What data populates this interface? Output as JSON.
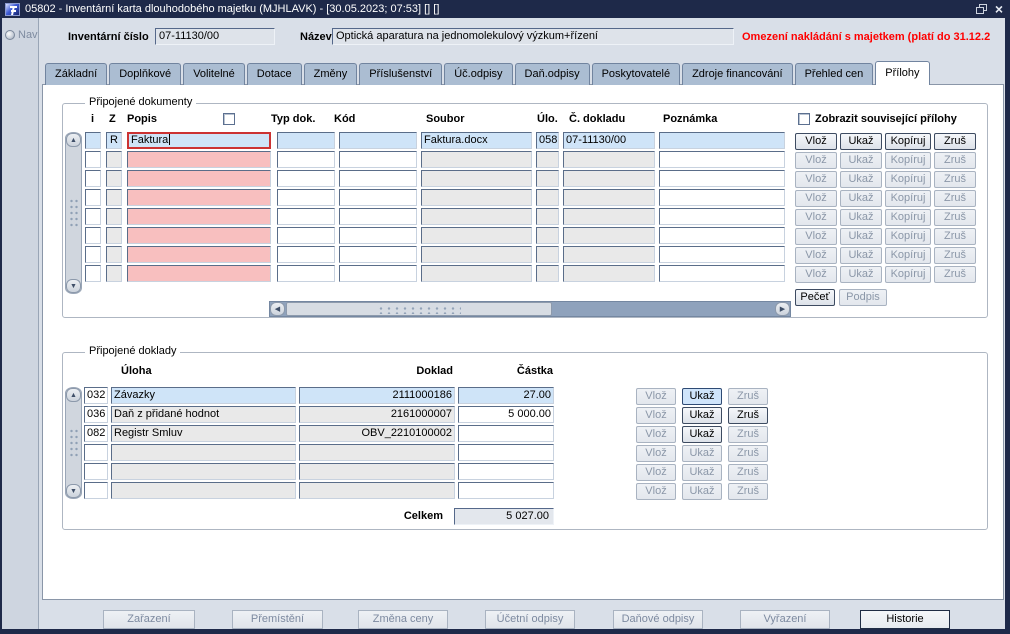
{
  "window": {
    "title": "05802 - Inventární karta dlouhodobého majetku (MJHLAVK) - [30.05.2023; 07:53]  [] []"
  },
  "icons": {
    "close": "×",
    "scroll_up": "▲",
    "scroll_down": "▼",
    "scroll_left": "◀",
    "scroll_right": "▶"
  },
  "nav": {
    "label": "Nav"
  },
  "header": {
    "inventory_label": "Inventární číslo",
    "inventory_value": "07-11130/00",
    "name_label": "Název",
    "name_value": "Optická aparatura na jednomolekulový výzkum+řízení",
    "warning": "Omezení nakládání s majetkem (platí do 31.12.2"
  },
  "tabs": [
    "Základní",
    "Doplňkové",
    "Volitelné",
    "Dotace",
    "Změny",
    "Příslušenství",
    "Úč.odpisy",
    "Daň.odpisy",
    "Poskytovatelé",
    "Zdroje financování",
    "Přehled cen",
    "Přílohy"
  ],
  "active_tab": "Přílohy",
  "documents": {
    "legend": "Připojené dokumenty",
    "headers": {
      "i": "i",
      "z": "Z",
      "popis": "Popis",
      "typ": "Typ dok.",
      "kod": "Kód",
      "soubor": "Soubor",
      "ulo": "Úlo.",
      "cdok": "Č. dokladu",
      "pozn": "Poznámka"
    },
    "show_related_label": "Zobrazit související přílohy",
    "buttons": {
      "insert": "Vlož",
      "show": "Ukaž",
      "copy": "Kopíruj",
      "remove": "Zruš"
    },
    "seal": "Pečeť",
    "sign": "Podpis",
    "rows": [
      {
        "i": "",
        "z": "R",
        "popis": "Faktura",
        "typ": "",
        "kod": "",
        "soubor": "Faktura.docx",
        "ulo": "058",
        "cdok": "07-11130/00",
        "pozn": ""
      },
      {
        "i": "",
        "z": "",
        "popis": "",
        "typ": "",
        "kod": "",
        "soubor": "",
        "ulo": "",
        "cdok": "",
        "pozn": ""
      },
      {
        "i": "",
        "z": "",
        "popis": "",
        "typ": "",
        "kod": "",
        "soubor": "",
        "ulo": "",
        "cdok": "",
        "pozn": ""
      },
      {
        "i": "",
        "z": "",
        "popis": "",
        "typ": "",
        "kod": "",
        "soubor": "",
        "ulo": "",
        "cdok": "",
        "pozn": ""
      },
      {
        "i": "",
        "z": "",
        "popis": "",
        "typ": "",
        "kod": "",
        "soubor": "",
        "ulo": "",
        "cdok": "",
        "pozn": ""
      },
      {
        "i": "",
        "z": "",
        "popis": "",
        "typ": "",
        "kod": "",
        "soubor": "",
        "ulo": "",
        "cdok": "",
        "pozn": ""
      },
      {
        "i": "",
        "z": "",
        "popis": "",
        "typ": "",
        "kod": "",
        "soubor": "",
        "ulo": "",
        "cdok": "",
        "pozn": ""
      },
      {
        "i": "",
        "z": "",
        "popis": "",
        "typ": "",
        "kod": "",
        "soubor": "",
        "ulo": "",
        "cdok": "",
        "pozn": ""
      }
    ]
  },
  "receipts": {
    "legend": "Připojené doklady",
    "headers": {
      "uloha": "Úloha",
      "doklad": "Doklad",
      "castka": "Částka"
    },
    "buttons": {
      "insert": "Vlož",
      "show": "Ukaž",
      "remove": "Zruš"
    },
    "total_label": "Celkem",
    "total_value": "5 027.00",
    "rows": [
      {
        "code": "032",
        "name": "Závazky",
        "doc": "2111000186",
        "amount": "27.00"
      },
      {
        "code": "036",
        "name": "Daň z přidané hodnot",
        "doc": "2161000007",
        "amount": "5 000.00"
      },
      {
        "code": "082",
        "name": "Registr Smluv",
        "doc": "OBV_2210100002",
        "amount": ""
      },
      {
        "code": "",
        "name": "",
        "doc": "",
        "amount": ""
      },
      {
        "code": "",
        "name": "",
        "doc": "",
        "amount": ""
      },
      {
        "code": "",
        "name": "",
        "doc": "",
        "amount": ""
      }
    ]
  },
  "bottom_buttons": [
    {
      "label": "Zařazení",
      "enabled": false
    },
    {
      "label": "Přemístění",
      "enabled": false
    },
    {
      "label": "Změna ceny",
      "enabled": false
    },
    {
      "label": "Účetní odpisy",
      "enabled": false
    },
    {
      "label": "Daňové odpisy",
      "enabled": false
    },
    {
      "label": "Vyřazení",
      "enabled": false
    },
    {
      "label": "Historie",
      "enabled": true
    }
  ],
  "colors": {
    "titlebar": "#1e2949",
    "warning_red": "#ff0000",
    "current_row": "#cfe4f8",
    "required_pink": "#f8bfbf",
    "tab_inactive": "#abbdd2"
  }
}
